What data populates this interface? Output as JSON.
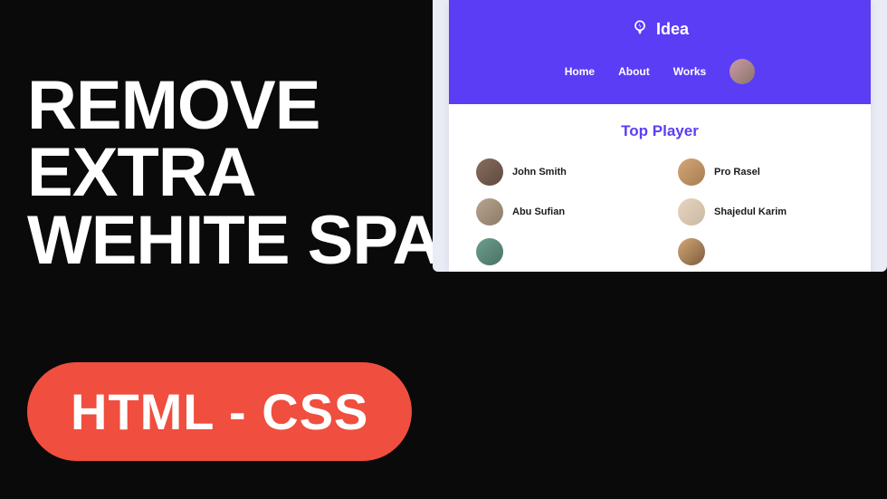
{
  "headline": {
    "line1": "REMOVE",
    "line2": "EXTRA",
    "line3": "WEHITE SPACE"
  },
  "pill": {
    "label": "HTML - CSS"
  },
  "site": {
    "brand": "Idea",
    "nav": {
      "home": "Home",
      "about": "About",
      "works": "Works"
    },
    "section_title": "Top Player",
    "players": [
      {
        "name": "John Smith"
      },
      {
        "name": "Pro Rasel"
      },
      {
        "name": "Abu Sufian"
      },
      {
        "name": "Shajedul Karim"
      }
    ]
  }
}
